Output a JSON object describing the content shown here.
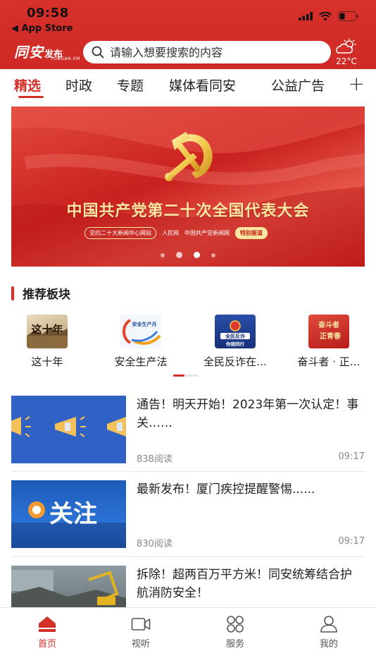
{
  "status_bar": {
    "time": "09:58",
    "back_label": "◀ App Store"
  },
  "header": {
    "logo_main": "同安",
    "logo_sub": "发布",
    "logo_en": "TONGAN.XM",
    "search_placeholder": "请输入想要搜索的内容",
    "weather_temp": "22°C",
    "weather_icon": "partly-cloudy-icon"
  },
  "tabs": [
    {
      "label": "精选",
      "active": true
    },
    {
      "label": "时政"
    },
    {
      "label": "专题"
    },
    {
      "label": "媒体看同安"
    },
    {
      "label": "公益广告"
    }
  ],
  "tab_add_label": "+",
  "banner": {
    "title": "中国共产党第二十次全国代表大会",
    "chip1": "党的二十大新闻中心网站",
    "text2": "人民网",
    "text3": "中国共产党新闻网",
    "chip4": "特别报道",
    "dots": 4,
    "active_dot": 2
  },
  "section": {
    "title": "推荐板块"
  },
  "modules": [
    {
      "label": "这十年",
      "icon_text": "这十年"
    },
    {
      "label": "安全生产法",
      "icon_text": "安全生产月"
    },
    {
      "label": "全民反诈在…",
      "icon_text": "全民反诈 你我同行"
    },
    {
      "label": "奋斗者 · 正…",
      "icon_text": "奋斗者 正青春"
    }
  ],
  "news": [
    {
      "title": "通告！明天开始！2023年第一次认定！事关……",
      "reads": "838阅读",
      "time": "09:17"
    },
    {
      "title": "最新发布！厦门疾控提醒警惕......",
      "reads": "830阅读",
      "time": "09:17",
      "thumb_text": "关注"
    },
    {
      "title": "拆除！超两百万平方米！同安统筹结合护航消防安全！",
      "reads": "",
      "time": ""
    }
  ],
  "bottom_nav": [
    {
      "label": "首页",
      "icon": "home-icon",
      "active": true
    },
    {
      "label": "视听",
      "icon": "video-icon"
    },
    {
      "label": "服务",
      "icon": "grid-icon"
    },
    {
      "label": "我的",
      "icon": "user-icon"
    }
  ],
  "colors": {
    "brand_red": "#d3302a",
    "banner_gold": "#fbe6a2"
  }
}
